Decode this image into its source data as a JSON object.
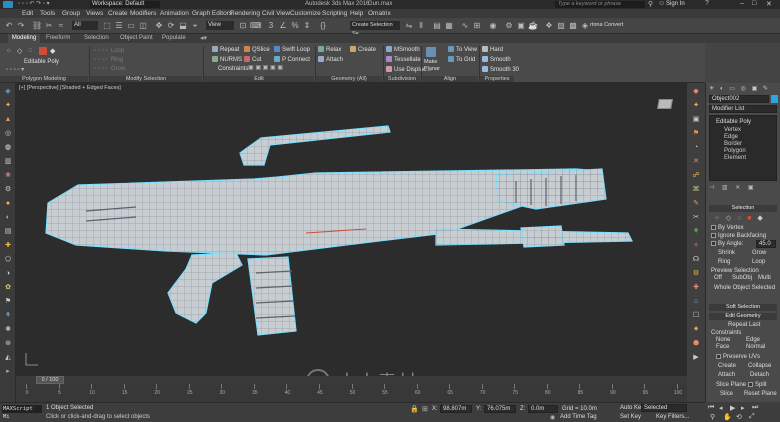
{
  "title_bar": {
    "workspace": "Workspace: Default",
    "app": "Autodesk 3ds Max 2016",
    "file": "Gun.max",
    "search_placeholder": "Type a keyword or phrase",
    "sign_in": "Sign In"
  },
  "menu": [
    "Edit",
    "Tools",
    "Group",
    "Views",
    "Create",
    "Modifiers",
    "Animation",
    "Graph Editors",
    "Rendering",
    "Civil View",
    "Customize",
    "Scripting",
    "Help",
    "Omatrix"
  ],
  "toolbar": {
    "selection_filter": "All",
    "view_dropdown": "View",
    "named_set": "Create Selection Se",
    "convert_label": "rtona Convert"
  },
  "ribbon_tabs": [
    "Modeling",
    "Freeform",
    "Selection",
    "Object Paint",
    "Populate"
  ],
  "ribbon": {
    "editable_poly": "Editable Poly",
    "polygon_modeling": "Polygon Modeling",
    "modify_selection": "Modify Selection",
    "edit_items": [
      "Repeat",
      "QSlice",
      "Swift Loop",
      "NURMS",
      "Cut",
      "P Connect",
      "Constraints"
    ],
    "edit_group": "Edit",
    "geometry_items": [
      "Relax",
      "Create",
      "Attach"
    ],
    "geometry_group": "Geometry (All)",
    "subdivision_items": [
      "MSmooth",
      "Tessellate",
      "Use Displac..."
    ],
    "subdivision_group": "Subdivision",
    "make_planar": "Make Planar",
    "align_items": [
      "To View",
      "To Grid"
    ],
    "align_group": "Align",
    "properties_items": [
      "Hard",
      "Smooth",
      "Smooth 30"
    ],
    "properties_group": "Properties"
  },
  "viewport": {
    "label": "[+] [Perspective] [Shaded + Edged Faces]"
  },
  "command_panel": {
    "object_name": "Object002",
    "modifier_list": "Modifier List",
    "stack": [
      "Editable Poly",
      "Vertex",
      "Edge",
      "Border",
      "Polygon",
      "Element"
    ],
    "selection_title": "Selection",
    "by_vertex": "By Vertex",
    "ignore_backfacing": "Ignore Backfacing",
    "by_angle": "By Angle:",
    "angle_value": "45.0",
    "shrink": "Shrink",
    "grow": "Grow",
    "ring": "Ring",
    "loop": "Loop",
    "preview_selection": "Preview Selection",
    "preview_options": [
      "Off",
      "SubObj",
      "Multi"
    ],
    "whole_object": "Whole Object Selected",
    "soft_selection": "Soft Selection",
    "edit_geometry": "Edit Geometry",
    "repeat_last": "Repeat Last",
    "constraints": "Constraints",
    "constraint_options": [
      "None",
      "Edge",
      "Face",
      "Normal"
    ],
    "preserve_uvs": "Preserve UVs",
    "create": "Create",
    "collapse": "Collapse",
    "attach": "Attach",
    "detach": "Detach",
    "slice_plane": "Slice Plane",
    "split": "Split",
    "slice": "Slice",
    "reset_plane": "Reset Plane"
  },
  "timeline": {
    "frame": "0 / 100",
    "ticks": [
      "0",
      "5",
      "10",
      "15",
      "20",
      "25",
      "30",
      "35",
      "40",
      "45",
      "50",
      "55",
      "60",
      "65",
      "70",
      "75",
      "80",
      "85",
      "90",
      "95",
      "100"
    ]
  },
  "status": {
    "maxscript": "MAXScript Mi",
    "selected": "1 Object Selected",
    "hint": "Click or click-and-drag to select objects",
    "x": "98.807m",
    "y": "76.075m",
    "z": "0.0m",
    "grid": "Grid = 10.0m",
    "add_time_tag": "Add Time Tag",
    "auto_key": "Auto Key",
    "selected_dd": "Selected",
    "set_key": "Set Key",
    "key_filters": "Key Filters..."
  },
  "watermark": "人人素材"
}
